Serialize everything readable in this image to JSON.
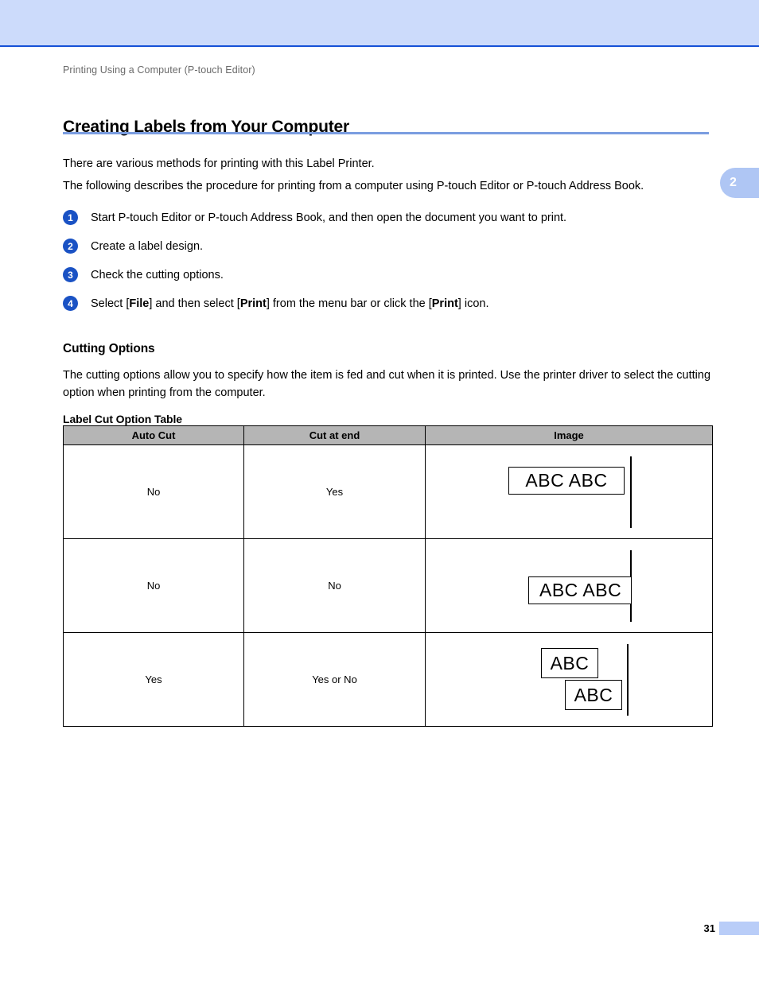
{
  "header": {
    "breadcrumb": "Printing Using a Computer (P-touch Editor)",
    "chapter_tab": "2"
  },
  "title": "Creating Labels from Your Computer",
  "intro": {
    "paragraph_1": "There are various methods for printing with this Label Printer.",
    "paragraph_2": "The following describes the procedure for printing from a computer using P-touch Editor or P-touch Address Book."
  },
  "steps": [
    {
      "number": "1",
      "text": "Start P-touch Editor or P-touch Address Book, and then open the document you want to print."
    },
    {
      "number": "2",
      "text": "Create a label design."
    },
    {
      "number": "3",
      "text": "Check the cutting options."
    },
    {
      "number": "4",
      "text": "Select [File] and then select [Print] from the menu bar or click the [Print] icon.",
      "segments": {
        "a": "Select [",
        "b": "File",
        "c": "] and then select [",
        "d": "Print",
        "e": "] from the menu bar or click the [",
        "f": "Print",
        "g": "] icon."
      }
    }
  ],
  "cutting_options": {
    "heading": "Cutting Options",
    "description": "The cutting options allow you to specify how the item is fed and cut when it is printed. Use the printer driver to select the cutting option when printing from the computer.",
    "table_heading": "Label Cut Option Table"
  },
  "table": {
    "columns": [
      "Auto Cut",
      "Cut at end",
      "Image"
    ],
    "rows": [
      {
        "auto_cut": "No",
        "cut_at_end": "Yes",
        "image_labels": [
          "ABC  ABC"
        ]
      },
      {
        "auto_cut": "No",
        "cut_at_end": "No",
        "image_labels": [
          "ABC  ABC"
        ]
      },
      {
        "auto_cut": "Yes",
        "cut_at_end": "Yes or No",
        "image_labels": [
          "ABC",
          "ABC"
        ]
      }
    ]
  },
  "footer": {
    "page_number": "31"
  },
  "colors": {
    "band": "#ccdbfb",
    "rule": "#1551d6",
    "title_underline": "#7a9de0",
    "step_badge": "#1a52c4",
    "table_header": "#b5b5b5",
    "chapter_tab": "#afc6f4",
    "footer_bar": "#b9cdf8"
  }
}
